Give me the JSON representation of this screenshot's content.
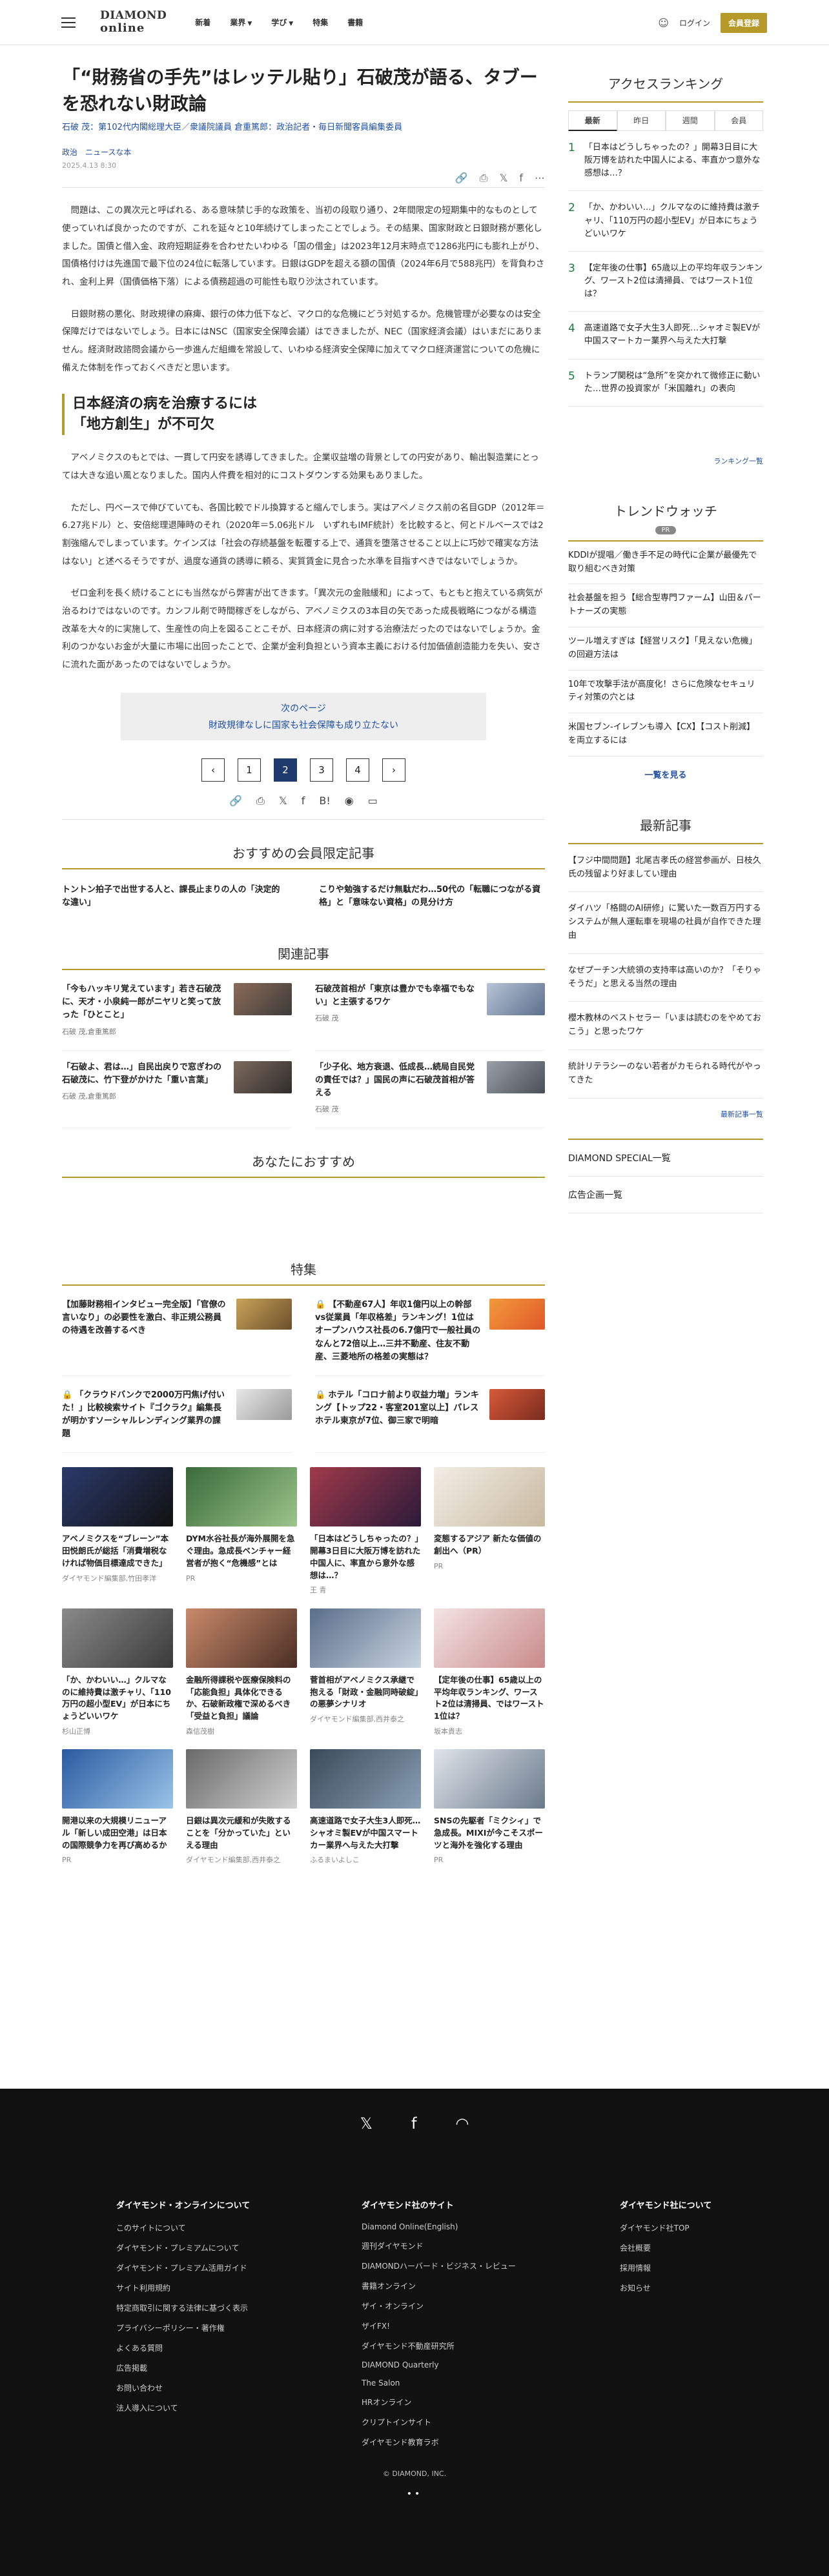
{
  "header": {
    "logo_line1": "DIAMOND",
    "logo_line2": "online",
    "nav": [
      {
        "label": "新着"
      },
      {
        "label": "業界"
      },
      {
        "label": "学び"
      },
      {
        "label": "特集"
      },
      {
        "label": "書籍"
      }
    ],
    "login": "ログイン",
    "member": "会員登録"
  },
  "article": {
    "title": "「“財務省の手先”はレッテル貼り」石破茂が語る、タブーを恐れない財政論",
    "authors": "石破 茂：第102代内閣総理大臣／衆議院議員  倉重篤郎：政治記者・毎日新聞客員編集委員",
    "tags": [
      "政治",
      "ニュースな本"
    ],
    "date": "2025.4.13 8:30",
    "paragraphs": [
      "問題は、この異次元と呼ばれる、ある意味禁じ手的な政策を、当初の段取り通り、2年間限定の短期集中的なものとして使っていれば良かったのですが、これを延々と10年続けてしまったことでしょう。その結果、国家財政と日銀財務が悪化しました。国債と借入金、政府短期証券を合わせたいわゆる「国の借金」は2023年12月末時点で1286兆円にも膨れ上がり、国債格付けは先進国で最下位の24位に転落しています。日銀はGDPを超える額の国債（2024年6月で588兆円）を背負わされ、金利上昇（国債価格下落）による債務超過の可能性も取り沙汰されています。",
      "日銀財務の悪化、財政規律の麻痺、銀行の体力低下など、マクロ的な危機にどう対処するか。危機管理が必要なのは安全保障だけではないでしょう。日本にはNSC（国家安全保障会議）はできましたが、NEC（国家経済会議）はいまだにありません。経済財政諮問会議から一歩進んだ組織を常設して、いわゆる経済安全保障に加えてマクロ経済運営についての危機に備えた体制を作っておくべきだと思います。"
    ],
    "h2_line1": "日本経済の病を治療するには",
    "h2_line2": "「地方創生」が不可欠",
    "paragraphs2": [
      "アベノミクスのもとでは、一貫して円安を誘導してきました。企業収益増の背景としての円安があり、輸出製造業にとっては大きな追い風となりました。国内人件費を相対的にコストダウンする効果もありました。",
      "ただし、円ベースで伸びていても、各国比較でドル換算すると縮んでしまう。実はアベノミクス前の名目GDP（2012年＝6.27兆ドル）と、安倍総理退陣時のそれ（2020年＝5.06兆ドル　いずれもIMF統計）を比較すると、何とドルベースでは2割強縮んでしまっています。ケインズは「社会の存続基盤を転覆する上で、通貨を堕落させること以上に巧妙で確実な方法はない」と述べるそうですが、過度な通貨の誘導に頼る、実質賃金に見合った水準を目指すべきではないでしょうか。",
      "ゼロ金利を長く続けることにも当然ながら弊害が出てきます。「異次元の金融緩和」によって、もともと抱えている病気が治るわけではないのです。カンフル剤で時間稼ぎをしながら、アベノミクスの3本目の矢であった成長戦略につながる構造改革を大々的に実施して、生産性の向上を図ることこそが、日本経済の病に対する治療法だったのではないでしょうか。金利のつかないお金が大量に市場に出回ったことで、企業が金利負担という資本主義における付加価値創造能力を失い、安さに流れた面があったのではないでしょうか。"
    ],
    "next_label": "次のページ",
    "next_title": "財政規律なしに国家も社会保障も成り立たない",
    "pages": [
      "1",
      "2",
      "3",
      "4"
    ],
    "current_page": "2"
  },
  "recommend": {
    "title": "おすすめの会員限定記事",
    "items": [
      "トントン拍子で出世する人と、課長止まりの人の「決定的な違い」",
      "こりや勉強するだけ無駄だわ…50代の「転職につながる資格」と「意味ない資格」の見分け方"
    ]
  },
  "related": {
    "title": "関連記事",
    "items": [
      {
        "title": "「今もハッキリ覚えています」若き石破茂に、天才・小泉純一郎がニヤリと笑って放った「ひとこと」",
        "by": "石破 茂,倉重篤郎"
      },
      {
        "title": "石破茂首相が「東京は豊かでも幸福でもない」と主張するワケ",
        "by": "石破 茂"
      },
      {
        "title": "「石破よ、君は…」自民出戻りで窓ぎわの石破茂に、竹下登がかけた「重い言葉」",
        "by": "石破 茂,倉重篤郎"
      },
      {
        "title": "「少子化、地方衰退、低成長…続局自民党の責任では？」国民の声に石破茂首相が答える",
        "by": "石破 茂"
      }
    ]
  },
  "anata": {
    "title": "あなたにおすすめ"
  },
  "tokushu": {
    "title": "特集",
    "items": [
      "【加藤財務相インタビュー完全版】「官僚の言いなり」の必要性を激白、非正規公務員の待遇を改善するべき",
      "【不動産67人】年収1億円以上の幹部vs従業員「年収格差」ランキング！1位はオープンハウス社長の6.7億円で一般社員のなんと72倍以上…三井不動産、住友不動産、三菱地所の格差の実態は？",
      "「クラウドバンクで2000万円焦げ付いた！」比較検索サイト『ゴクラク』編集長が明かすソーシャルレンディング業界の課題",
      "ホテル「コロナ前より収益力増」ランキング【トップ22・客室201室以上】パレスホテル東京が7位、御三家で明暗"
    ]
  },
  "cards": [
    {
      "title": "アベノミクスを“ブレーン”本田悦朗氏が総括「消費増税なければ物価目標達成できた」",
      "by": "ダイヤモンド編集部,竹田孝洋"
    },
    {
      "title": "DYM水谷社長が海外展開を急ぐ理由。急成長ベンチャー経営者が抱く“危機感”とは",
      "by": "PR"
    },
    {
      "title": "「日本はどうしちゃったの？」開幕3日目に大阪万博を訪れた中国人に、率直から意外な感想は…？",
      "by": "王 青"
    },
    {
      "title": "変態するアジア 新たな価値の創出へ（PR）",
      "by": "PR"
    },
    {
      "title": "「か、かわいい…」クルマなのに維持費は激チャリ、「110万円の超小型EV」が日本にちょうどいいワケ",
      "by": "杉山正博"
    },
    {
      "title": "金融所得課税や医療保険料の「応能負担」具体化できるか、石破新政権で深めるべき「受益と負担」議論",
      "by": "森信茂樹"
    },
    {
      "title": "菅首相がアベノミクス承継で抱える「財政・金融同時破綻」の悪夢シナリオ",
      "by": "ダイヤモンド編集部,西井泰之"
    },
    {
      "title": "【定年後の仕事】65歳以上の平均年収ランキング、ワースト2位は清掃員、ではワースト1位は？",
      "by": "坂本貴志"
    },
    {
      "title": "開港以来の大規模リニューアル「新しい成田空港」は日本の国際競争力を再び高めるか",
      "by": "PR"
    },
    {
      "title": "日銀は異次元緩和が失敗することを「分かっていた」といえる理由",
      "by": "ダイヤモンド編集部,西井泰之"
    },
    {
      "title": "高速道路で女子大生3人即死…シャオミ製EVが中国スマートカー業界へ与えた大打撃",
      "by": "ふるまいよしこ"
    },
    {
      "title": "SNSの先駆者「ミクシィ」で急成長。MIXIが今こそスポーツと海外を強化する理由",
      "by": "PR"
    }
  ],
  "sidebar": {
    "ranking_title": "アクセスランキング",
    "tabs": [
      "最新",
      "昨日",
      "週間",
      "会員"
    ],
    "ranking": [
      {
        "num": "1",
        "title": "「日本はどうしちゃったの？」開幕3日目に大阪万博を訪れた中国人による、率直かつ意外な感想は…？"
      },
      {
        "num": "2",
        "title": "「か、かわいい…」クルマなのに維持費は激チャリ、「110万円の超小型EV」が日本にちょうどいいワケ"
      },
      {
        "num": "3",
        "title": "【定年後の仕事】65歳以上の平均年収ランキング、ワースト2位は清掃員、ではワースト1位は？"
      },
      {
        "num": "4",
        "title": "高速道路で女子大生3人即死…シャオミ製EVが中国スマートカー業界へ与えた大打撃"
      },
      {
        "num": "5",
        "title": "トランプ関税は“急所”を突かれて微修正に動いた…世界の投資家が「米国離れ」の表向"
      }
    ],
    "ranking_more": "ランキング一覧",
    "trend_title": "トレンドウォッチ",
    "trend_pr": "PR",
    "trend": [
      "KDDIが提唱／働き手不足の時代に企業が最優先で取り組むべき対策",
      "社会基盤を担う【総合型専門ファーム】山田＆パートナーズの実態",
      "ツール増えすぎは【経営リスク】「見えない危機」の回避方法は",
      "10年で攻撃手法が高度化！さらに危険なセキュリティ対策の穴とは",
      "米国セブン-イレブンも導入【CX】【コスト削減】を両立するには"
    ],
    "trend_more": "一覧を見る",
    "latest_title": "最新記事",
    "latest": [
      "【フジ中間問題】北尾吉孝氏の経営参画が、日枝久氏の残留より好ましてい理由",
      "ダイハツ「格闘のAI研修」に驚いた一数百万円するシステムが無人運転車を現場の社員が自作できた理由",
      "なぜプーチン大統領の支持率は高いのか？「そりゃそうだ」と思える当然の理由",
      "櫻木教林のベストセラー「いまは読むのをやめておこう」と思ったワケ",
      "統計リテラシーのない若者がカモられる時代がやってきた"
    ],
    "latest_more": "最新記事一覧",
    "special": "DIAMOND SPECIAL一覧",
    "ad": "広告企画一覧"
  },
  "footer": {
    "col1_title": "ダイヤモンド・オンラインについて",
    "col1": [
      "このサイトについて",
      "ダイヤモンド・プレミアムについて",
      "ダイヤモンド・プレミアム活用ガイド",
      "サイト利用規約",
      "特定商取引に関する法律に基づく表示",
      "プライバシーポリシー・著作権",
      "よくある質問",
      "広告掲載",
      "お問い合わせ",
      "法人導入について"
    ],
    "col2_title": "ダイヤモンド社のサイト",
    "col2": [
      "Diamond Online(English)",
      "週刊ダイヤモンド",
      "DIAMONDハーバード・ビジネス・レビュー",
      "書籍オンライン",
      "ザイ・オンライン",
      "ザイFX!",
      "ダイヤモンド不動産研究所",
      "DIAMOND Quarterly",
      "The Salon",
      "HRオンライン",
      "クリプトインサイト",
      "ダイヤモンド教育ラボ"
    ],
    "col3_title": "ダイヤモンド社について",
    "col3": [
      "ダイヤモンド社TOP",
      "会社概要",
      "採用情報",
      "お知らせ"
    ],
    "copyright": "© DIAMOND, INC."
  }
}
